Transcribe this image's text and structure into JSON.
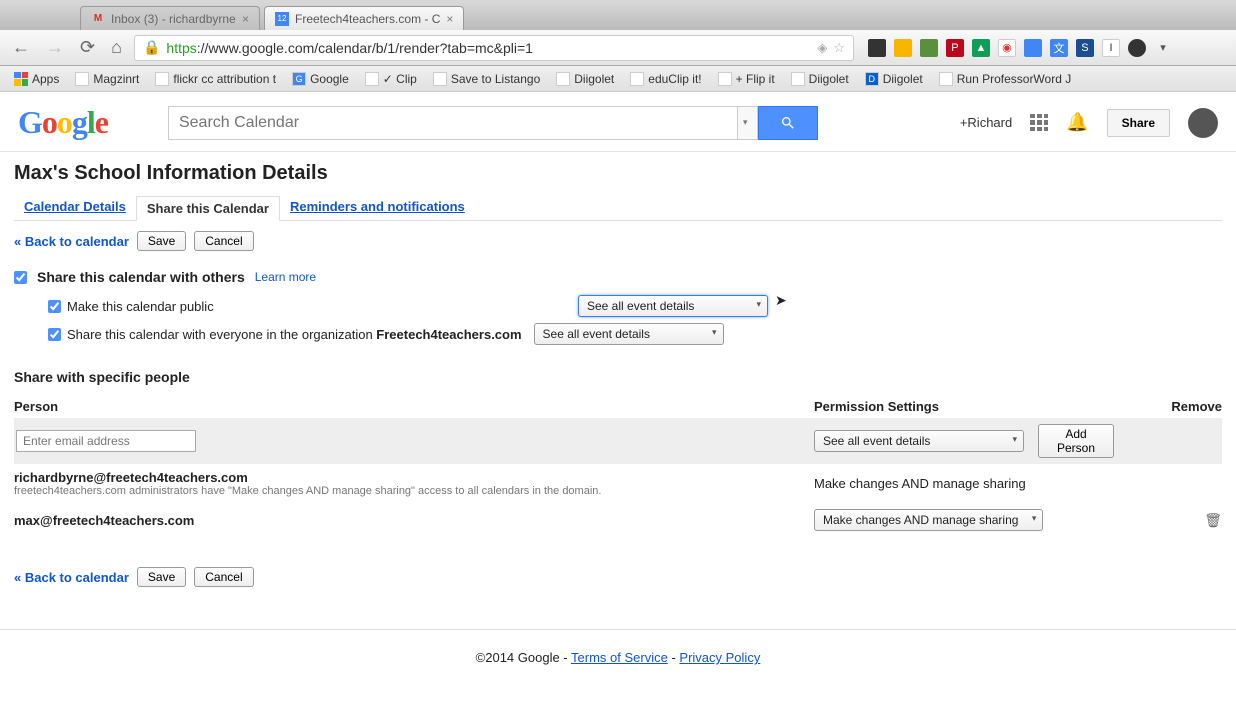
{
  "browser": {
    "tabs": [
      {
        "title": "Inbox (3) - richardbyrne",
        "favicon": "M"
      },
      {
        "title": "Freetech4teachers.com - C",
        "favicon": "12"
      }
    ],
    "url_https": "https",
    "url_rest": "://www.google.com/calendar/b/1/render?tab=mc&pli=1"
  },
  "bookmarks": [
    "Apps",
    "Magzinrt",
    "flickr cc attribution t",
    "Google",
    "✓ Clip",
    "Save to Listango",
    "Diigolet",
    "eduClip it!",
    "+ Flip it",
    "Diigolet",
    "Diigolet",
    "Run ProfessorWord J"
  ],
  "header": {
    "search_placeholder": "Search Calendar",
    "user": "+Richard",
    "share": "Share"
  },
  "page_title": "Max's School Information Details",
  "tabs": {
    "calendar_details": "Calendar Details",
    "share_calendar": "Share this Calendar",
    "reminders": "Reminders and notifications"
  },
  "actions": {
    "back": "« Back to calendar",
    "save": "Save",
    "cancel": "Cancel"
  },
  "share_section": {
    "title": "Share this calendar with others",
    "learn_more": "Learn more",
    "make_public": "Make this calendar public",
    "share_org_prefix": "Share this calendar with everyone in the organization ",
    "org_name": "Freetech4teachers.com",
    "select_public": "See all event details",
    "select_org": "See all event details"
  },
  "people_section": {
    "title": "Share with specific people",
    "col_person": "Person",
    "col_perm": "Permission Settings",
    "col_remove": "Remove",
    "email_placeholder": "Enter email address",
    "select_new": "See all event details",
    "add_person": "Add Person",
    "rows": [
      {
        "email": "richardbyrne@freetech4teachers.com",
        "sub": "freetech4teachers.com administrators have \"Make changes AND manage sharing\" access to all calendars in the domain.",
        "perm_text": "Make changes AND manage sharing"
      },
      {
        "email": "max@freetech4teachers.com",
        "perm_select": "Make changes AND manage sharing"
      }
    ]
  },
  "footer": {
    "copyright": "©2014 Google - ",
    "terms": "Terms of Service",
    "sep": " - ",
    "privacy": "Privacy Policy"
  }
}
